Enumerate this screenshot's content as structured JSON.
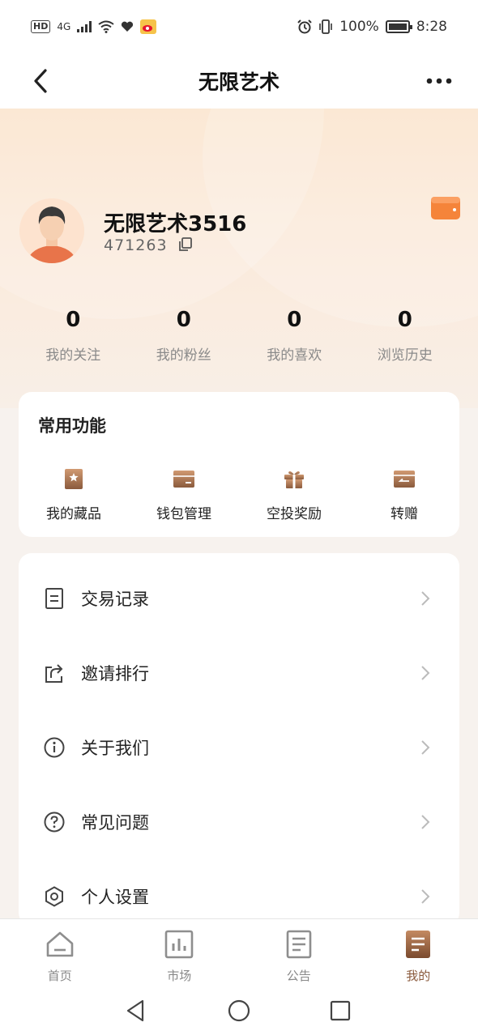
{
  "status_bar": {
    "hd": "HD",
    "network": "4G",
    "battery": "100%",
    "time": "8:28"
  },
  "nav": {
    "title": "无限艺术"
  },
  "profile": {
    "name": "无限艺术3516",
    "id": "471263"
  },
  "stats": [
    {
      "value": "0",
      "label": "我的关注"
    },
    {
      "value": "0",
      "label": "我的粉丝"
    },
    {
      "value": "0",
      "label": "我的喜欢"
    },
    {
      "value": "0",
      "label": "浏览历史"
    }
  ],
  "functions": {
    "title": "常用功能",
    "items": [
      {
        "label": "我的藏品",
        "icon": "collection-icon"
      },
      {
        "label": "钱包管理",
        "icon": "wallet-icon"
      },
      {
        "label": "空投奖励",
        "icon": "gift-icon"
      },
      {
        "label": "转赠",
        "icon": "transfer-icon"
      }
    ]
  },
  "menu": [
    {
      "label": "交易记录",
      "icon": "document-icon"
    },
    {
      "label": "邀请排行",
      "icon": "share-icon"
    },
    {
      "label": "关于我们",
      "icon": "info-icon"
    },
    {
      "label": "常见问题",
      "icon": "question-icon"
    },
    {
      "label": "个人设置",
      "icon": "settings-icon"
    }
  ],
  "tabs": [
    {
      "label": "首页",
      "icon": "home-icon"
    },
    {
      "label": "市场",
      "icon": "chart-icon"
    },
    {
      "label": "公告",
      "icon": "notice-icon"
    },
    {
      "label": "我的",
      "icon": "mine-icon",
      "active": true
    }
  ],
  "colors": {
    "accent": "#8a5a3c",
    "wallet_orange": "#f5843a",
    "icon_brown": "#a8734f"
  }
}
